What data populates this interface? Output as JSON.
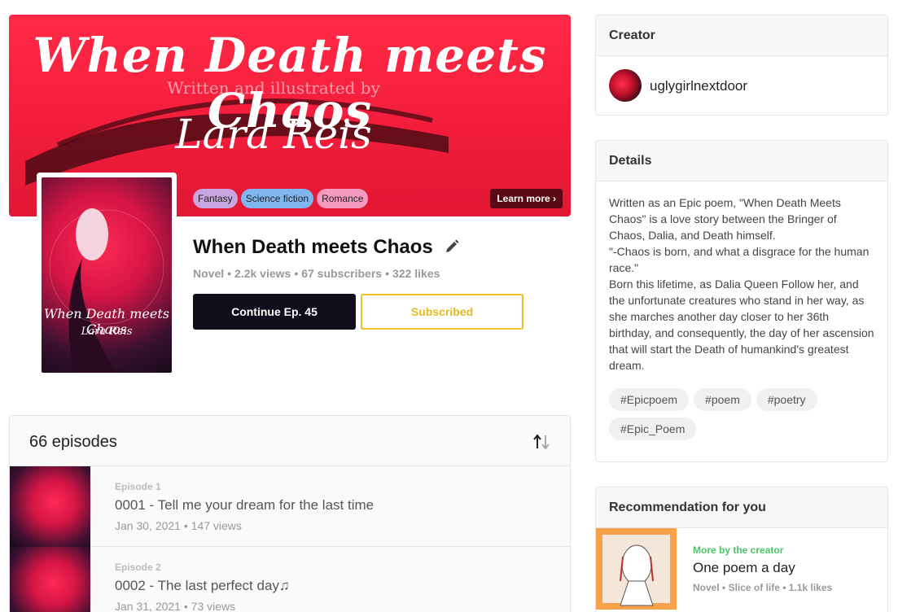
{
  "banner": {
    "title": "When Death meets Chaos",
    "subtitle": "Written and illustrated by",
    "author": "Lara Reis",
    "learn_more": "Learn more ›",
    "genres": [
      {
        "label": "Fantasy",
        "color": "#c9a6e0"
      },
      {
        "label": "Science fiction",
        "color": "#7fb6f0"
      },
      {
        "label": "Romance",
        "color": "#f79ac0"
      }
    ]
  },
  "cover": {
    "title": "When Death meets Chaos",
    "author": "Lara Reis"
  },
  "series": {
    "title": "When Death meets Chaos",
    "type": "Novel",
    "views": "2.2k views",
    "subscribers": "67 subscribers",
    "likes": "322 likes",
    "continue_label": "Continue Ep. 45",
    "subscribed_label": "Subscribed"
  },
  "episodes": {
    "count_label": "66 episodes",
    "items": [
      {
        "number": "Episode 1",
        "title": "0001 - Tell me your dream for the last time",
        "date": "Jan 30, 2021",
        "views": "147 views"
      },
      {
        "number": "Episode 2",
        "title": "0002 - The last perfect day♫",
        "date": "Jan 31, 2021",
        "views": "73 views"
      }
    ]
  },
  "creator": {
    "heading": "Creator",
    "name": "uglygirlnextdoor"
  },
  "details": {
    "heading": "Details",
    "text": "Written as an Epic poem, \"When Death Meets Chaos\" is a love story between the Bringer of Chaos, Dalia, and Death himself.\n\"-Chaos is born, and what a disgrace for the human race.\"\nBorn this lifetime, as Dalia Queen Follow her, and the unfortunate creatures who stand in her way, as she marches another day closer to her 36th birthday, and consequently, the day of her ascension that will start the Death of humankind's greatest dream.",
    "tags": [
      "#Epicpoem",
      "#poem",
      "#poetry",
      "#Epic_Poem"
    ]
  },
  "recommendation": {
    "heading": "Recommendation for you",
    "label": "More by the creator",
    "title": "One poem a day",
    "type": "Novel",
    "genre": "Slice of life",
    "likes": "1.1k likes"
  },
  "colors": {
    "banner_red": "#f21d3b",
    "button_dark": "#0f0e1a",
    "subscribed_yellow": "#f0c020",
    "creator_green": "#4cc36a"
  }
}
